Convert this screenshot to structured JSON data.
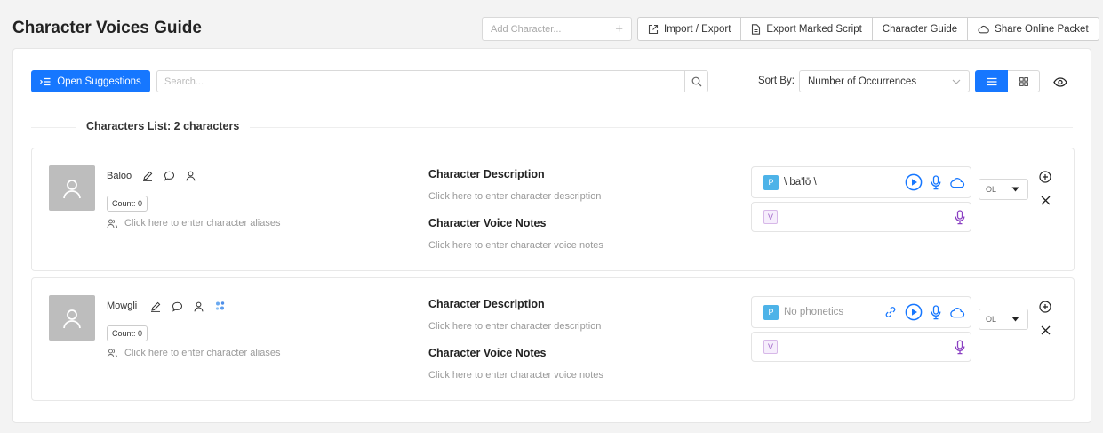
{
  "page": {
    "title": "Character Voices Guide"
  },
  "add_character": {
    "placeholder": "Add Character..."
  },
  "toolbar": {
    "import_export": "Import / Export",
    "export_marked_script": "Export Marked Script",
    "character_guide": "Character Guide",
    "share_online_packet": "Share Online Packet"
  },
  "controls": {
    "open_suggestions": "Open Suggestions",
    "search_placeholder": "Search...",
    "sort_label": "Sort By:",
    "sort_value": "Number of Occurrences"
  },
  "list": {
    "label": "Characters List: 2 characters"
  },
  "characters": [
    {
      "name": "Baloo",
      "count": "Count: 0",
      "aliases_placeholder": "Click here to enter character aliases",
      "description_heading": "Character Description",
      "description_placeholder": "Click here to enter character description",
      "voice_notes_heading": "Character Voice Notes",
      "voice_notes_placeholder": "Click here to enter character voice notes",
      "phonetic_badge": "P",
      "phonetic": "\\ ba'lō \\",
      "voice_badge": "V",
      "ol": "OL"
    },
    {
      "name": "Mowgli",
      "count": "Count: 0",
      "aliases_placeholder": "Click here to enter character aliases",
      "description_heading": "Character Description",
      "description_placeholder": "Click here to enter character description",
      "voice_notes_heading": "Character Voice Notes",
      "voice_notes_placeholder": "Click here to enter character voice notes",
      "phonetic_badge": "P",
      "phonetic": "No phonetics",
      "voice_badge": "V",
      "ol": "OL"
    }
  ],
  "colors": {
    "primary": "#1677ff",
    "phonetic_badge": "#4db3e8",
    "voice_icon": "#8a3fc2",
    "avatar": "#bdbdbd"
  }
}
